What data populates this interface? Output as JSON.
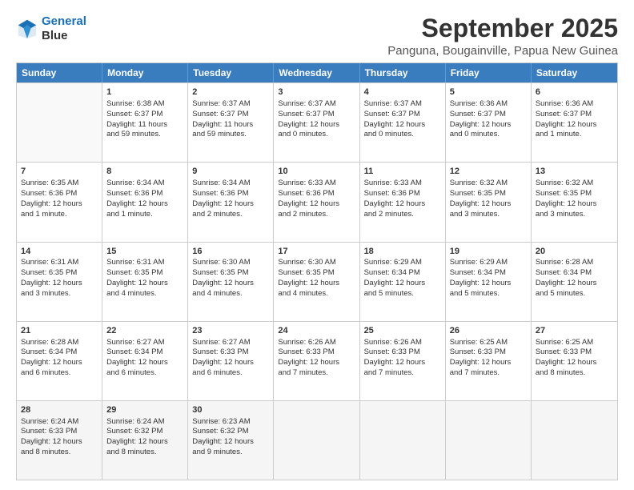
{
  "header": {
    "logo_line1": "General",
    "logo_line2": "Blue",
    "main_title": "September 2025",
    "subtitle": "Panguna, Bougainville, Papua New Guinea"
  },
  "days": [
    "Sunday",
    "Monday",
    "Tuesday",
    "Wednesday",
    "Thursday",
    "Friday",
    "Saturday"
  ],
  "weeks": [
    [
      {
        "day": "",
        "lines": []
      },
      {
        "day": "1",
        "lines": [
          "Sunrise: 6:38 AM",
          "Sunset: 6:37 PM",
          "Daylight: 11 hours",
          "and 59 minutes."
        ]
      },
      {
        "day": "2",
        "lines": [
          "Sunrise: 6:37 AM",
          "Sunset: 6:37 PM",
          "Daylight: 11 hours",
          "and 59 minutes."
        ]
      },
      {
        "day": "3",
        "lines": [
          "Sunrise: 6:37 AM",
          "Sunset: 6:37 PM",
          "Daylight: 12 hours",
          "and 0 minutes."
        ]
      },
      {
        "day": "4",
        "lines": [
          "Sunrise: 6:37 AM",
          "Sunset: 6:37 PM",
          "Daylight: 12 hours",
          "and 0 minutes."
        ]
      },
      {
        "day": "5",
        "lines": [
          "Sunrise: 6:36 AM",
          "Sunset: 6:37 PM",
          "Daylight: 12 hours",
          "and 0 minutes."
        ]
      },
      {
        "day": "6",
        "lines": [
          "Sunrise: 6:36 AM",
          "Sunset: 6:37 PM",
          "Daylight: 12 hours",
          "and 1 minute."
        ]
      }
    ],
    [
      {
        "day": "7",
        "lines": [
          "Sunrise: 6:35 AM",
          "Sunset: 6:36 PM",
          "Daylight: 12 hours",
          "and 1 minute."
        ]
      },
      {
        "day": "8",
        "lines": [
          "Sunrise: 6:34 AM",
          "Sunset: 6:36 PM",
          "Daylight: 12 hours",
          "and 1 minute."
        ]
      },
      {
        "day": "9",
        "lines": [
          "Sunrise: 6:34 AM",
          "Sunset: 6:36 PM",
          "Daylight: 12 hours",
          "and 2 minutes."
        ]
      },
      {
        "day": "10",
        "lines": [
          "Sunrise: 6:33 AM",
          "Sunset: 6:36 PM",
          "Daylight: 12 hours",
          "and 2 minutes."
        ]
      },
      {
        "day": "11",
        "lines": [
          "Sunrise: 6:33 AM",
          "Sunset: 6:36 PM",
          "Daylight: 12 hours",
          "and 2 minutes."
        ]
      },
      {
        "day": "12",
        "lines": [
          "Sunrise: 6:32 AM",
          "Sunset: 6:35 PM",
          "Daylight: 12 hours",
          "and 3 minutes."
        ]
      },
      {
        "day": "13",
        "lines": [
          "Sunrise: 6:32 AM",
          "Sunset: 6:35 PM",
          "Daylight: 12 hours",
          "and 3 minutes."
        ]
      }
    ],
    [
      {
        "day": "14",
        "lines": [
          "Sunrise: 6:31 AM",
          "Sunset: 6:35 PM",
          "Daylight: 12 hours",
          "and 3 minutes."
        ]
      },
      {
        "day": "15",
        "lines": [
          "Sunrise: 6:31 AM",
          "Sunset: 6:35 PM",
          "Daylight: 12 hours",
          "and 4 minutes."
        ]
      },
      {
        "day": "16",
        "lines": [
          "Sunrise: 6:30 AM",
          "Sunset: 6:35 PM",
          "Daylight: 12 hours",
          "and 4 minutes."
        ]
      },
      {
        "day": "17",
        "lines": [
          "Sunrise: 6:30 AM",
          "Sunset: 6:35 PM",
          "Daylight: 12 hours",
          "and 4 minutes."
        ]
      },
      {
        "day": "18",
        "lines": [
          "Sunrise: 6:29 AM",
          "Sunset: 6:34 PM",
          "Daylight: 12 hours",
          "and 5 minutes."
        ]
      },
      {
        "day": "19",
        "lines": [
          "Sunrise: 6:29 AM",
          "Sunset: 6:34 PM",
          "Daylight: 12 hours",
          "and 5 minutes."
        ]
      },
      {
        "day": "20",
        "lines": [
          "Sunrise: 6:28 AM",
          "Sunset: 6:34 PM",
          "Daylight: 12 hours",
          "and 5 minutes."
        ]
      }
    ],
    [
      {
        "day": "21",
        "lines": [
          "Sunrise: 6:28 AM",
          "Sunset: 6:34 PM",
          "Daylight: 12 hours",
          "and 6 minutes."
        ]
      },
      {
        "day": "22",
        "lines": [
          "Sunrise: 6:27 AM",
          "Sunset: 6:34 PM",
          "Daylight: 12 hours",
          "and 6 minutes."
        ]
      },
      {
        "day": "23",
        "lines": [
          "Sunrise: 6:27 AM",
          "Sunset: 6:33 PM",
          "Daylight: 12 hours",
          "and 6 minutes."
        ]
      },
      {
        "day": "24",
        "lines": [
          "Sunrise: 6:26 AM",
          "Sunset: 6:33 PM",
          "Daylight: 12 hours",
          "and 7 minutes."
        ]
      },
      {
        "day": "25",
        "lines": [
          "Sunrise: 6:26 AM",
          "Sunset: 6:33 PM",
          "Daylight: 12 hours",
          "and 7 minutes."
        ]
      },
      {
        "day": "26",
        "lines": [
          "Sunrise: 6:25 AM",
          "Sunset: 6:33 PM",
          "Daylight: 12 hours",
          "and 7 minutes."
        ]
      },
      {
        "day": "27",
        "lines": [
          "Sunrise: 6:25 AM",
          "Sunset: 6:33 PM",
          "Daylight: 12 hours",
          "and 8 minutes."
        ]
      }
    ],
    [
      {
        "day": "28",
        "lines": [
          "Sunrise: 6:24 AM",
          "Sunset: 6:33 PM",
          "Daylight: 12 hours",
          "and 8 minutes."
        ]
      },
      {
        "day": "29",
        "lines": [
          "Sunrise: 6:24 AM",
          "Sunset: 6:32 PM",
          "Daylight: 12 hours",
          "and 8 minutes."
        ]
      },
      {
        "day": "30",
        "lines": [
          "Sunrise: 6:23 AM",
          "Sunset: 6:32 PM",
          "Daylight: 12 hours",
          "and 9 minutes."
        ]
      },
      {
        "day": "",
        "lines": []
      },
      {
        "day": "",
        "lines": []
      },
      {
        "day": "",
        "lines": []
      },
      {
        "day": "",
        "lines": []
      }
    ]
  ]
}
